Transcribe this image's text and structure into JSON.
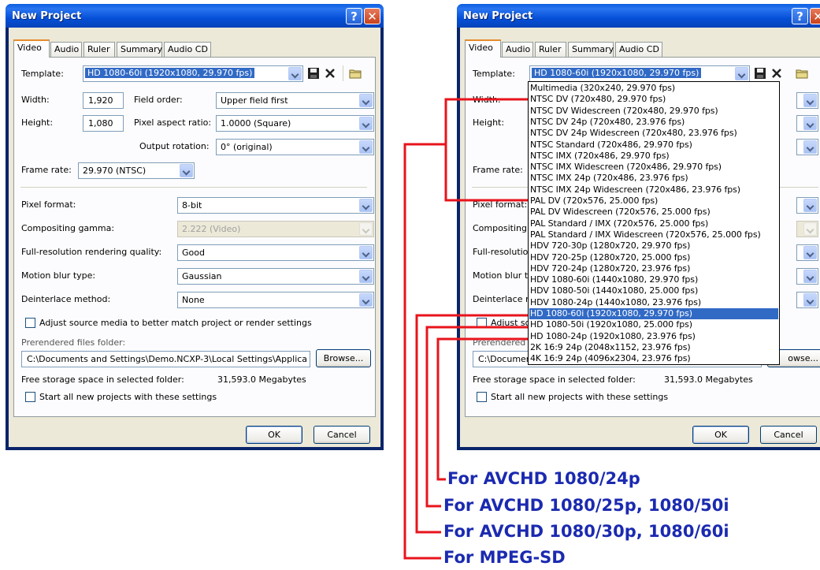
{
  "dialog": {
    "title": "New Project",
    "tabs": [
      "Video",
      "Audio",
      "Ruler",
      "Summary",
      "Audio CD"
    ],
    "template_label": "Template:",
    "template_value": "HD 1080-60i (1920x1080, 29.970 fps)",
    "width_label": "Width:",
    "width_value": "1,920",
    "height_label": "Height:",
    "height_value": "1,080",
    "field_order_label": "Field order:",
    "field_order_value": "Upper field first",
    "par_label": "Pixel aspect ratio:",
    "par_value": "1.0000 (Square)",
    "rotation_label": "Output rotation:",
    "rotation_value": "0° (original)",
    "frame_rate_label": "Frame rate:",
    "frame_rate_value": "29.970 (NTSC)",
    "pixel_format_label": "Pixel format:",
    "pixel_format_value": "8-bit",
    "gamma_label": "Compositing gamma:",
    "gamma_value": "2.222 (Video)",
    "quality_label": "Full-resolution rendering quality:",
    "quality_value": "Good",
    "blur_label": "Motion blur type:",
    "blur_value": "Gaussian",
    "deinterlace_label": "Deinterlace method:",
    "deinterlace_value": "None",
    "adjust_label": "Adjust source media to better match project or render settings",
    "prerendered_label": "Prerendered files folder:",
    "prerendered_value": "C:\\Documents and Settings\\Demo.NCXP-3\\Local Settings\\Applica",
    "browse_label": "Browse...",
    "free_label": "Free storage space in selected folder:",
    "free_value": "31,593.0 Megabytes",
    "start_label": "Start all new projects with these settings",
    "ok_label": "OK",
    "cancel_label": "Cancel"
  },
  "right": {
    "width_label_cut": "Width:",
    "height_label": "Height:",
    "frame_rate_cut": "Frame rate:",
    "pixel_format_cut": "Pixel format:",
    "gamma_cut": "Compositing",
    "quality_cut": "Full-resolutio",
    "blur_cut": "Motion blur t",
    "deinterlace_cut": "Deinterlace r",
    "adjust_cut": "Adjust so",
    "prerendered_cut": "Prerendered",
    "path_cut": "C:\\Documen",
    "browse_cut": "owse..."
  },
  "dropdown_items": [
    "Multimedia (320x240, 29.970 fps)",
    "NTSC DV (720x480, 29.970 fps)",
    "NTSC DV Widescreen (720x480, 29.970 fps)",
    "NTSC DV 24p (720x480, 23.976 fps)",
    "NTSC DV 24p Widescreen (720x480, 23.976 fps)",
    "NTSC Standard (720x486, 29.970 fps)",
    "NTSC IMX (720x486, 29.970 fps)",
    "NTSC IMX Widescreen (720x486, 29.970 fps)",
    "NTSC IMX 24p (720x486, 23.976 fps)",
    "NTSC IMX 24p Widescreen (720x486, 23.976 fps)",
    "PAL DV (720x576, 25.000 fps)",
    "PAL DV Widescreen (720x576, 25.000 fps)",
    "PAL Standard / IMX (720x576, 25.000 fps)",
    "PAL Standard / IMX Widescreen (720x576, 25.000 fps)",
    "HDV 720-30p (1280x720, 29.970 fps)",
    "HDV 720-25p (1280x720, 25.000 fps)",
    "HDV 720-24p (1280x720, 23.976 fps)",
    "HDV 1080-60i (1440x1080, 29.970 fps)",
    "HDV 1080-50i (1440x1080, 25.000 fps)",
    "HDV 1080-24p (1440x1080, 23.976 fps)",
    "HD 1080-60i (1920x1080, 29.970 fps)",
    "HD 1080-50i (1920x1080, 25.000 fps)",
    "HD 1080-24p (1920x1080, 23.976 fps)",
    "2K 16:9 24p (2048x1152, 23.976 fps)",
    "4K 16:9 24p (4096x2304, 23.976 fps)"
  ],
  "selected_index": 20,
  "annotations": [
    "For AVCHD 1080/24p",
    "For AVCHD 1080/25p, 1080/50i",
    "For AVCHD 1080/30p, 1080/60i",
    "For MPEG-SD"
  ],
  "colors": {
    "annotation_line": "#e8141c",
    "annotation_text": "#1b2ab0",
    "selection": "#316ac5"
  }
}
